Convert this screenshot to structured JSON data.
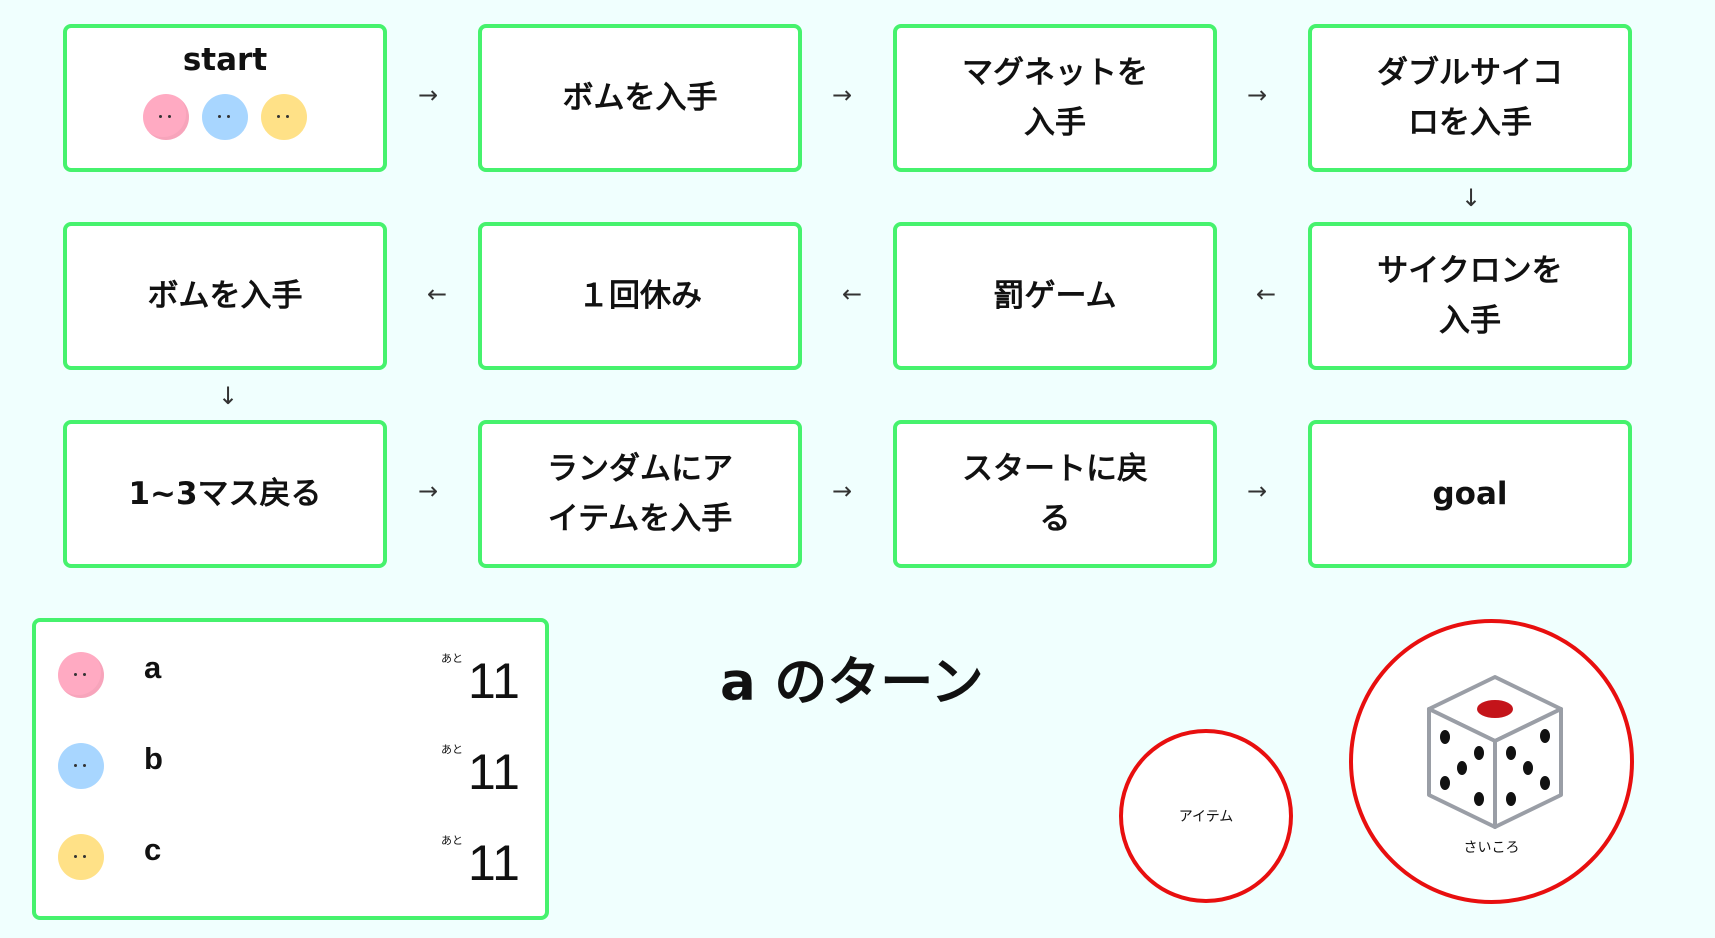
{
  "board": {
    "cells": [
      {
        "label": "start"
      },
      {
        "label": "ボムを入手"
      },
      {
        "label": "マグネットを入手"
      },
      {
        "label": "ダブルサイコロを入手"
      },
      {
        "label": "ボムを入手"
      },
      {
        "label": "１回休み"
      },
      {
        "label": "罰ゲーム"
      },
      {
        "label": "サイクロンを入手"
      },
      {
        "label": "1~3マス戻る"
      },
      {
        "label": "ランダムにアイテムを入手"
      },
      {
        "label": "スタートに戻る"
      },
      {
        "label": "goal"
      }
    ],
    "arrows": {
      "right": "→",
      "left": "←",
      "down": "↓"
    }
  },
  "players": [
    {
      "name": "a",
      "color": "#ffaac2",
      "remaining_prefix": "あと",
      "remaining": "11"
    },
    {
      "name": "b",
      "color": "#a8d6ff",
      "remaining_prefix": "あと",
      "remaining": "11"
    },
    {
      "name": "c",
      "color": "#ffe187",
      "remaining_prefix": "あと",
      "remaining": "11"
    }
  ],
  "turn": {
    "text": "a のターン"
  },
  "controls": {
    "item_label": "アイテム",
    "dice_label": "さいころ",
    "dice_icon": "dice-icon"
  },
  "colors": {
    "cell_border": "#46f26d",
    "button_border": "#e80f0f",
    "background": "#f0fffe"
  }
}
